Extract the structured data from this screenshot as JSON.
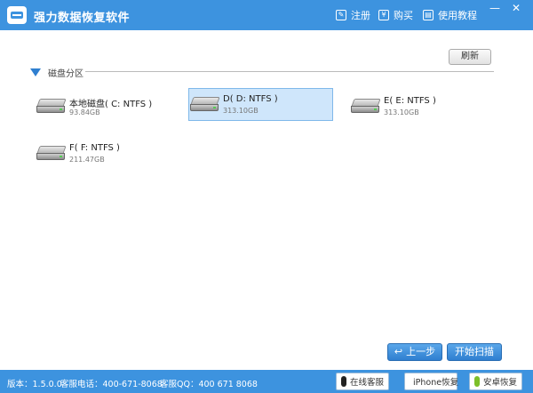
{
  "window": {
    "title": "强力数据恢复软件",
    "minimize_label": "—",
    "close_label": "✕"
  },
  "toolbar": {
    "register_label": "注册",
    "buy_label": "购买",
    "tutorial_label": "使用教程"
  },
  "section": {
    "title": "磁盘分区",
    "refresh_label": "刷新"
  },
  "drives": [
    {
      "name": "本地磁盘( C: NTFS )",
      "size": "93.84GB",
      "selected": false
    },
    {
      "name": "D( D: NTFS )",
      "size": "313.10GB",
      "selected": true
    },
    {
      "name": "E( E: NTFS )",
      "size": "313.10GB",
      "selected": false
    },
    {
      "name": "F( F: NTFS )",
      "size": "211.47GB",
      "selected": false
    }
  ],
  "actions": {
    "prev_label": "上一步",
    "start_label": "开始扫描"
  },
  "status": {
    "version": "版本：1.5.0.0",
    "phone": "客服电话：400-671-8068",
    "qq": "客服QQ：400 671 8068",
    "online_service_label": "在线客服",
    "iphone_recovery_label": "iPhone恢复",
    "android_recovery_label": "安卓恢复"
  },
  "colors": {
    "accent": "#3d93df",
    "selected_bg": "#cfe6fb"
  }
}
